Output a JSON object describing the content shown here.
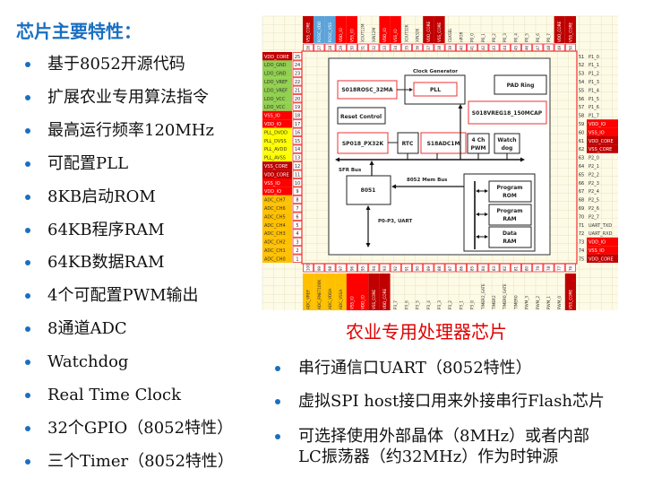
{
  "left": {
    "title": "芯片主要特性：",
    "items": [
      "基于8052开源代码",
      "扩展农业专用算法指令",
      "最高运行频率120MHz",
      "可配置PLL",
      "8KB启动ROM",
      "64KB程序RAM",
      "64KB数据RAM",
      "4个可配置PWM输出",
      "8通道ADC",
      "Watchdog",
      "Real Time Clock",
      "32个GPIO（8052特性）",
      "三个Timer（8052特性）"
    ]
  },
  "diagram": {
    "caption": "农业专用处理器芯片",
    "colors": {
      "dark_red": "#c00000",
      "red": "#ff0000",
      "blue": "#5ba3d9",
      "green": "#92d050",
      "yellow": "#ffff00",
      "orange": "#ffc000",
      "grid": "#fdfbe6"
    },
    "top_pins": [
      [
        "26",
        "VSS_CORE",
        "dark_red"
      ],
      [
        "27",
        "ROSC_VDD",
        "blue"
      ],
      [
        "28",
        "ROSC_VSS",
        "blue"
      ],
      [
        "29",
        "VDD_IO",
        "red"
      ],
      [
        "30",
        "VSS_IO",
        "red"
      ],
      [
        "31",
        "XOUT12M",
        ""
      ],
      [
        "32",
        "XIN12M",
        ""
      ],
      [
        "33",
        "VDD_IO",
        "red"
      ],
      [
        "34",
        "VSS_IO",
        "red"
      ],
      [
        "35",
        "XOUT32K",
        ""
      ],
      [
        "36",
        "XIN32K",
        ""
      ],
      [
        "37",
        "VDD_CORE",
        "dark_red"
      ],
      [
        "38",
        "VSS_CORE",
        "dark_red"
      ],
      [
        "39",
        "CLKSEL",
        ""
      ],
      [
        "40",
        "nPOR",
        ""
      ],
      [
        "41",
        "P0_0",
        ""
      ],
      [
        "42",
        "P0_1",
        ""
      ],
      [
        "43",
        "P0_2",
        ""
      ],
      [
        "44",
        "P0_3",
        ""
      ],
      [
        "45",
        "P0_4",
        ""
      ],
      [
        "46",
        "P0_5",
        ""
      ],
      [
        "47",
        "P0_6",
        ""
      ],
      [
        "48",
        "P0_7",
        ""
      ],
      [
        "49",
        "VDD_CORE",
        "dark_red"
      ],
      [
        "50",
        "VSS_CORE",
        "dark_red"
      ]
    ],
    "left_pins": [
      [
        "25",
        "VDD_CORE",
        "dark_red"
      ],
      [
        "24",
        "LDO_GND",
        "green"
      ],
      [
        "23",
        "LDO_GND",
        "green"
      ],
      [
        "22",
        "LDO_VREF",
        "green"
      ],
      [
        "21",
        "LDO_VREF",
        "green"
      ],
      [
        "20",
        "LDO_VCC",
        "green"
      ],
      [
        "19",
        "LDO_VCC",
        "green"
      ],
      [
        "18",
        "VSS_IO",
        "red"
      ],
      [
        "17",
        "VDD_IO",
        "red"
      ],
      [
        "16",
        "PLL_DVDD",
        "yellow"
      ],
      [
        "15",
        "PLL_DVSS",
        "yellow"
      ],
      [
        "14",
        "PLL_AVDD",
        "yellow"
      ],
      [
        "13",
        "PLL_AVSS",
        "yellow"
      ],
      [
        "12",
        "VSS_CORE",
        "dark_red"
      ],
      [
        "11",
        "VDD_CORE",
        "dark_red"
      ],
      [
        "10",
        "VSS_IO",
        "red"
      ],
      [
        "9",
        "VDD_IO",
        "red"
      ],
      [
        "8",
        "ADC_CH7",
        "orange"
      ],
      [
        "7",
        "ADC_CH6",
        "orange"
      ],
      [
        "6",
        "ADC_CH5",
        "orange"
      ],
      [
        "5",
        "ADC_CH4",
        "orange"
      ],
      [
        "4",
        "ADC_CH3",
        "orange"
      ],
      [
        "3",
        "ADC_CH2",
        "orange"
      ],
      [
        "2",
        "ADC_CH1",
        "orange"
      ],
      [
        "1",
        "ADC_CH0",
        "orange"
      ]
    ],
    "right_pins": [
      [
        "51",
        "P1_0",
        ""
      ],
      [
        "52",
        "P1_1",
        ""
      ],
      [
        "53",
        "P1_2",
        ""
      ],
      [
        "54",
        "P1_3",
        ""
      ],
      [
        "55",
        "P1_4",
        ""
      ],
      [
        "56",
        "P1_5",
        ""
      ],
      [
        "57",
        "P1_6",
        ""
      ],
      [
        "58",
        "P1_7",
        ""
      ],
      [
        "59",
        "VDD_IO",
        "red"
      ],
      [
        "60",
        "VSS_IO",
        "red"
      ],
      [
        "61",
        "VDD_CORE",
        "dark_red"
      ],
      [
        "62",
        "VSS_CORE",
        "dark_red"
      ],
      [
        "63",
        "P2_0",
        ""
      ],
      [
        "64",
        "P2_1",
        ""
      ],
      [
        "65",
        "P2_2",
        ""
      ],
      [
        "66",
        "P2_3",
        ""
      ],
      [
        "67",
        "P2_4",
        ""
      ],
      [
        "68",
        "P2_5",
        ""
      ],
      [
        "69",
        "P2_6",
        ""
      ],
      [
        "70",
        "P2_7",
        ""
      ],
      [
        "71",
        "UART_TXD",
        ""
      ],
      [
        "72",
        "UART_RXD",
        ""
      ],
      [
        "73",
        "VDD_IO",
        "red"
      ],
      [
        "74",
        "VSS_IO",
        "red"
      ],
      [
        "75",
        "VDD_CORE",
        "dark_red"
      ]
    ],
    "bottom_pins": [
      [
        "100",
        "ADC_VREF",
        "orange"
      ],
      [
        "99",
        "ADC_RNET100K",
        "orange"
      ],
      [
        "98",
        "ADC_VDDA",
        "orange"
      ],
      [
        "97",
        "ADC_VSSA",
        "orange"
      ],
      [
        "96",
        "VSS_IO",
        "red"
      ],
      [
        "95",
        "VDD_IO",
        "red"
      ],
      [
        "94",
        "VSS_CORE",
        "dark_red"
      ],
      [
        "93",
        "VDD_CORE",
        "dark_red"
      ],
      [
        "92",
        "P3_7",
        ""
      ],
      [
        "91",
        "P3_6",
        ""
      ],
      [
        "90",
        "P3_5",
        ""
      ],
      [
        "89",
        "P3_4",
        ""
      ],
      [
        "88",
        "P3_3",
        ""
      ],
      [
        "87",
        "P3_2",
        ""
      ],
      [
        "86",
        "P3_1",
        ""
      ],
      [
        "85",
        "P3_0",
        ""
      ],
      [
        "84",
        "TIMER2_GATE",
        ""
      ],
      [
        "83",
        "TIMER2",
        ""
      ],
      [
        "82",
        "TIMER0_GATE",
        ""
      ],
      [
        "81",
        "TIMER0",
        ""
      ],
      [
        "80",
        "PWM_3",
        ""
      ],
      [
        "79",
        "PWM_2",
        ""
      ],
      [
        "78",
        "PWM_1",
        ""
      ],
      [
        "77",
        "PWM_0",
        ""
      ],
      [
        "76",
        "VSS_CORE",
        "dark_red"
      ]
    ],
    "blocks": {
      "clock_generator": "Clock Generator",
      "pll": "PLL",
      "rosc": "S018ROSC_32MA",
      "pad_ring": "PAD Ring",
      "vreg": "S018VREG18_150MCAP",
      "reset": "Reset Control",
      "px32k": "SP018_PX32K",
      "rtc": "RTC",
      "adc": "S18ADC1M",
      "pwm": [
        "4 Ch",
        "PWM"
      ],
      "watchdog": [
        "Watch",
        "dog"
      ],
      "sfr_bus": "SFR Bus",
      "cpu": "8051",
      "mem_bus": "8052 Mem Bus",
      "prom": [
        "Program",
        "ROM"
      ],
      "pram": [
        "Program",
        "RAM"
      ],
      "dram": [
        "Data",
        "RAM"
      ],
      "io": "P0-P3, UART"
    }
  },
  "right": {
    "items": [
      "串行通信口UART（8052特性）",
      "虚拟SPI host接口用来外接串行Flash芯片",
      "可选择使用外部晶体（8MHz）或者内部",
      "LC振荡器（约32MHz）作为时钟源"
    ]
  }
}
